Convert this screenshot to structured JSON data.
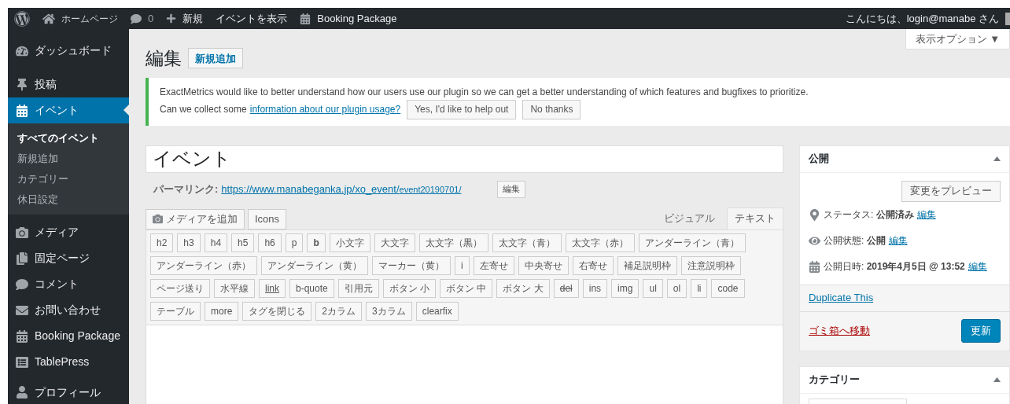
{
  "admin_bar": {
    "home": "ホームページ",
    "comments": "0",
    "new": "新規",
    "view": "イベントを表示",
    "plugin": "Booking Package",
    "greeting": "こんにちは、login@manabe さん"
  },
  "sidebar": {
    "items": [
      {
        "label": "ダッシュボード",
        "selected": false
      },
      {
        "label": "投稿",
        "selected": false
      },
      {
        "label": "イベント",
        "selected": true,
        "children": [
          {
            "label": "すべてのイベント",
            "selected": true
          },
          {
            "label": "新規追加",
            "selected": false
          },
          {
            "label": "カテゴリー",
            "selected": false
          },
          {
            "label": "休日設定",
            "selected": false
          }
        ]
      },
      {
        "label": "メディア",
        "selected": false
      },
      {
        "label": "固定ページ",
        "selected": false
      },
      {
        "label": "コメント",
        "selected": false
      },
      {
        "label": "お問い合わせ",
        "selected": false
      },
      {
        "label": "Booking Package",
        "selected": false
      },
      {
        "label": "TablePress",
        "selected": false
      },
      {
        "label": "プロフィール",
        "selected": false
      }
    ]
  },
  "screen_options": "表示オプション ▼",
  "heading": {
    "title": "編集",
    "add_new": "新規追加"
  },
  "notice": {
    "line1": "ExactMetrics would like to better understand how our users use our plugin so we can get a better understanding of which features and bugfixes to prioritize.",
    "line2": "Can we collect some",
    "link": "information about our plugin usage?",
    "buttons": [
      "Yes, I'd like to help out",
      "No thanks"
    ]
  },
  "title_field": {
    "value": "イベント"
  },
  "permalink": {
    "label": "パーマリンク:",
    "base": "https://www.manabeganka.jp/xo_event/",
    "slug": "event20190701/",
    "edit": "編集"
  },
  "media_buttons": [
    "メディアを追加",
    "Icons"
  ],
  "editor_tabs": [
    {
      "label": "ビジュアル",
      "selected": false
    },
    {
      "label": "テキスト",
      "selected": true
    }
  ],
  "quicktags": [
    [
      {
        "label": "h2",
        "kind": "plain"
      },
      {
        "label": "h3",
        "kind": "plain"
      },
      {
        "label": "h4",
        "kind": "plain"
      },
      {
        "label": "h5",
        "kind": "plain"
      },
      {
        "label": "h6",
        "kind": "plain"
      },
      {
        "label": "p",
        "kind": "plain"
      },
      {
        "label": "b",
        "kind": "bold"
      },
      {
        "label": "小文字",
        "kind": "plain"
      },
      {
        "label": "大文字",
        "kind": "plain"
      },
      {
        "label": "太文字（黒）",
        "kind": "plain"
      },
      {
        "label": "太文字（青）",
        "kind": "plain"
      },
      {
        "label": "太文字（赤）",
        "kind": "plain"
      },
      {
        "label": "アンダーライン（青）",
        "kind": "plain"
      }
    ],
    [
      {
        "label": "アンダーライン（赤）",
        "kind": "plain"
      },
      {
        "label": "アンダーライン（黄）",
        "kind": "plain"
      },
      {
        "label": "マーカー（黄）",
        "kind": "plain"
      },
      {
        "label": "i",
        "kind": "plain"
      },
      {
        "label": "左寄せ",
        "kind": "plain"
      },
      {
        "label": "中央寄せ",
        "kind": "plain"
      },
      {
        "label": "右寄せ",
        "kind": "plain"
      },
      {
        "label": "補足説明枠",
        "kind": "plain"
      },
      {
        "label": "注意説明枠",
        "kind": "plain"
      }
    ],
    [
      {
        "label": "ページ送り",
        "kind": "plain"
      },
      {
        "label": "水平線",
        "kind": "plain"
      },
      {
        "label": "link",
        "kind": "underline"
      },
      {
        "label": "b-quote",
        "kind": "plain"
      },
      {
        "label": "引用元",
        "kind": "plain"
      },
      {
        "label": "ボタン 小",
        "kind": "plain"
      },
      {
        "label": "ボタン 中",
        "kind": "plain"
      },
      {
        "label": "ボタン 大",
        "kind": "plain"
      },
      {
        "label": "del",
        "kind": "strike"
      },
      {
        "label": "ins",
        "kind": "plain"
      },
      {
        "label": "img",
        "kind": "plain"
      },
      {
        "label": "ul",
        "kind": "plain"
      },
      {
        "label": "ol",
        "kind": "plain"
      },
      {
        "label": "li",
        "kind": "plain"
      },
      {
        "label": "code",
        "kind": "plain"
      }
    ],
    [
      {
        "label": "テーブル",
        "kind": "plain"
      },
      {
        "label": "more",
        "kind": "plain"
      },
      {
        "label": "タグを閉じる",
        "kind": "plain"
      },
      {
        "label": "2カラム",
        "kind": "plain"
      },
      {
        "label": "3カラム",
        "kind": "plain"
      },
      {
        "label": "clearfix",
        "kind": "plain"
      }
    ]
  ],
  "publish": {
    "title": "公開",
    "preview": "変更をプレビュー",
    "rows": [
      {
        "text": "ステータス: **公開済み**",
        "link": "編集"
      },
      {
        "text": "公開状態: **公開**",
        "link": "編集"
      },
      {
        "text": "公開日時: **2019年4月5日 @ 13:52**",
        "link": "編集"
      }
    ],
    "duplicate": "Duplicate This",
    "trash": "ゴミ箱へ移動",
    "update": "更新"
  },
  "categories": {
    "title": "カテゴリー"
  }
}
